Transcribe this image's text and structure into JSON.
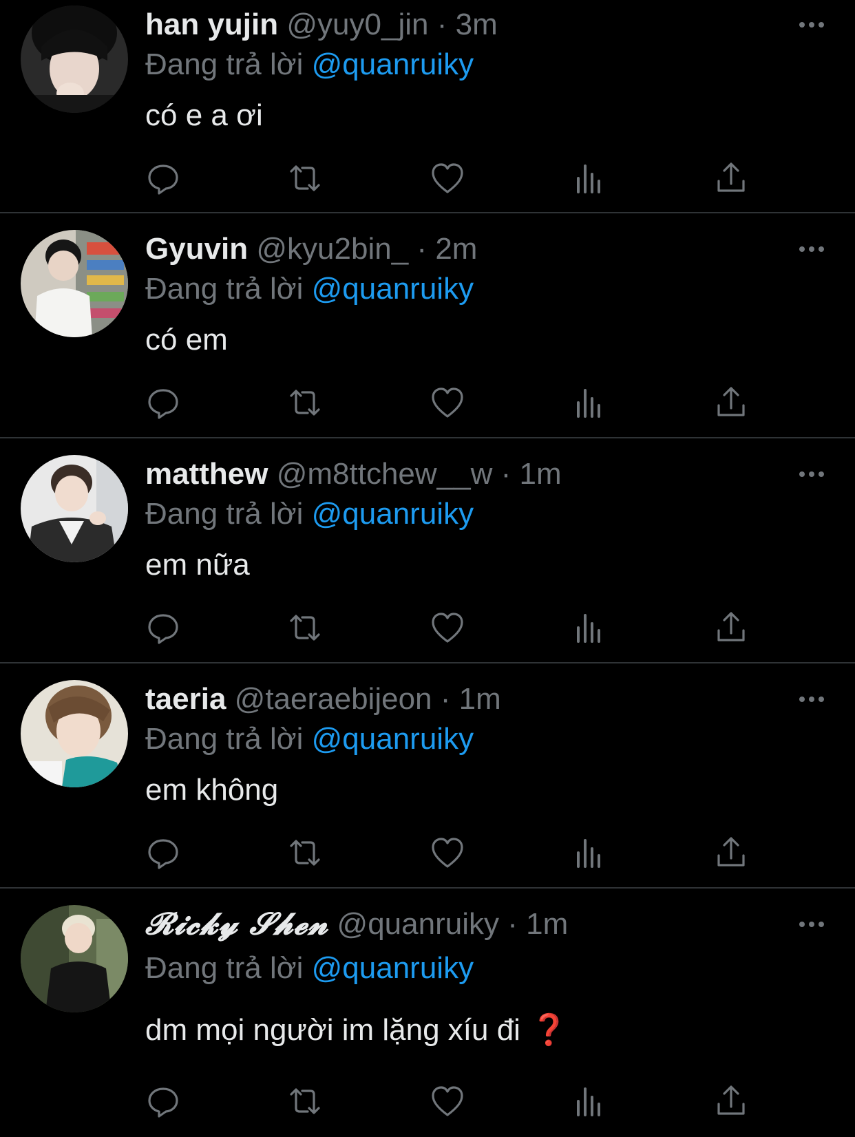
{
  "colors": {
    "background": "#000000",
    "text_primary": "#e7e9ea",
    "text_secondary": "#71767b",
    "mention": "#1d9bf0",
    "divider": "#2f3336",
    "question_mark": "#e0245e"
  },
  "reply_prefix": "Đang trả lời",
  "action_icons": [
    "reply-icon",
    "retweet-icon",
    "like-icon",
    "views-icon",
    "share-icon"
  ],
  "tweets": [
    {
      "name": "han yujin",
      "handle": "@yuy0_jin",
      "separator": "·",
      "time": "3m",
      "reply_to": "@quanruiky",
      "text": "có e a ơi"
    },
    {
      "name": "Gyuvin",
      "handle": "@kyu2bin_",
      "separator": "·",
      "time": "2m",
      "reply_to": "@quanruiky",
      "text": "có em"
    },
    {
      "name": "matthew",
      "handle": "@m8ttchew__w",
      "separator": "·",
      "time": "1m",
      "reply_to": "@quanruiky",
      "text": "em nữa"
    },
    {
      "name": "taeria",
      "handle": "@taeraebijeon",
      "separator": "·",
      "time": "1m",
      "reply_to": "@quanruiky",
      "text": "em không"
    },
    {
      "name": "𝓡𝓲𝓬𝓴𝔂 𝓢𝓱𝓮𝓷",
      "handle": "@quanruiky",
      "separator": "·",
      "time": "1m",
      "reply_to": "@quanruiky",
      "text": "dm mọi người im lặng xíu đi",
      "emoji": "❓"
    }
  ]
}
